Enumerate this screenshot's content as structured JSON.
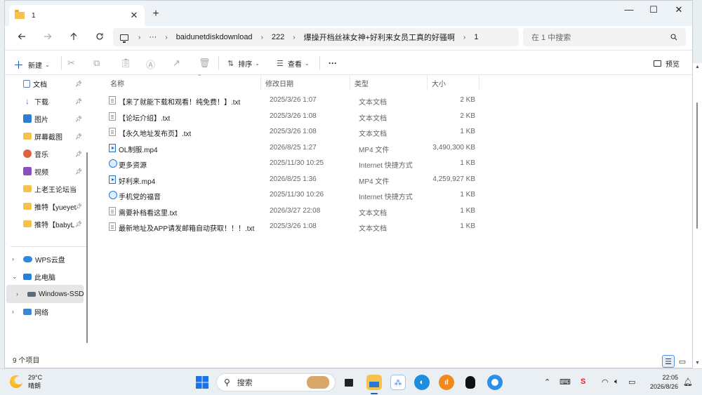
{
  "window": {
    "tab_title": "1",
    "tab_close": "✕",
    "new_tab": "+",
    "minimize": "—",
    "maximize": "☐",
    "close": "✕"
  },
  "address": {
    "more": "···",
    "sep": "›",
    "crumbs": [
      "baidunetdiskdownload",
      "222",
      "爆操开档丝袜女神+好利来女员工真的好骚啊",
      "1"
    ],
    "search_placeholder": "在 1 中搜索"
  },
  "toolbar": {
    "new_label": "新建",
    "sort_label": "排序",
    "view_label": "查看",
    "more_label": "···",
    "preview_label": "预览"
  },
  "sidebar": {
    "quick": [
      {
        "label": "文档",
        "icon": "document-icon",
        "color": "#5b7fbf"
      },
      {
        "label": "下载",
        "icon": "download-icon",
        "color": "#2a78d6"
      },
      {
        "label": "图片",
        "icon": "pictures-icon",
        "color": "#2d7ed2"
      },
      {
        "label": "屏幕截图",
        "icon": "folder-icon",
        "color": "#f5c24e"
      },
      {
        "label": "音乐",
        "icon": "music-icon",
        "color": "#e0623d"
      },
      {
        "label": "视频",
        "icon": "video-icon",
        "color": "#8a4fc4"
      },
      {
        "label": "上老王论坛当",
        "icon": "folder-icon",
        "color": "#f5c24e"
      },
      {
        "label": "推特【yueyet",
        "icon": "folder-icon",
        "color": "#f5c24e"
      },
      {
        "label": "推特【babyL",
        "icon": "folder-icon",
        "color": "#f5c24e"
      }
    ],
    "tree": [
      {
        "label": "WPS云盘",
        "icon": "cloud-icon",
        "expander": "›"
      },
      {
        "label": "此电脑",
        "icon": "computer-icon",
        "expander": "⌄"
      },
      {
        "label": "Windows-SSD",
        "icon": "drive-icon",
        "expander": "›"
      },
      {
        "label": "网络",
        "icon": "network-icon",
        "expander": "›"
      }
    ]
  },
  "columns": {
    "name": "名称",
    "modified": "修改日期",
    "type": "类型",
    "size": "大小"
  },
  "files": [
    {
      "name": "【来了就能下载和观看！纯免费！】.txt",
      "modified": "2025/3/26 1:07",
      "type": "文本文档",
      "size": "2 KB",
      "kind": "txt"
    },
    {
      "name": "【论坛介绍】.txt",
      "modified": "2025/3/26 1:08",
      "type": "文本文档",
      "size": "2 KB",
      "kind": "txt"
    },
    {
      "name": "【永久地址发布页】.txt",
      "modified": "2025/3/26 1:08",
      "type": "文本文档",
      "size": "1 KB",
      "kind": "txt"
    },
    {
      "name": "OL制服.mp4",
      "modified": "2026/8/25 1:27",
      "type": "MP4 文件",
      "size": "3,490,300 KB",
      "kind": "mp4"
    },
    {
      "name": "更多资源",
      "modified": "2025/11/30 10:25",
      "type": "Internet 快捷方式",
      "size": "1 KB",
      "kind": "url"
    },
    {
      "name": "好利来.mp4",
      "modified": "2026/8/25 1:36",
      "type": "MP4 文件",
      "size": "4,259,927 KB",
      "kind": "mp4"
    },
    {
      "name": "手机党的福音",
      "modified": "2025/11/30 10:26",
      "type": "Internet 快捷方式",
      "size": "1 KB",
      "kind": "url"
    },
    {
      "name": "需要补档看这里.txt",
      "modified": "2026/3/27 22:08",
      "type": "文本文档",
      "size": "1 KB",
      "kind": "txt"
    },
    {
      "name": "最新地址及APP请发邮箱自动获取！！！.txt",
      "modified": "2025/3/26 1:08",
      "type": "文本文档",
      "size": "1 KB",
      "kind": "txt"
    }
  ],
  "status": {
    "count_text": "9 个项目"
  },
  "taskbar": {
    "temperature": "29°C",
    "condition": "晴朗",
    "search_label": "搜索",
    "time": "22:05",
    "date": "2026/8/26"
  }
}
